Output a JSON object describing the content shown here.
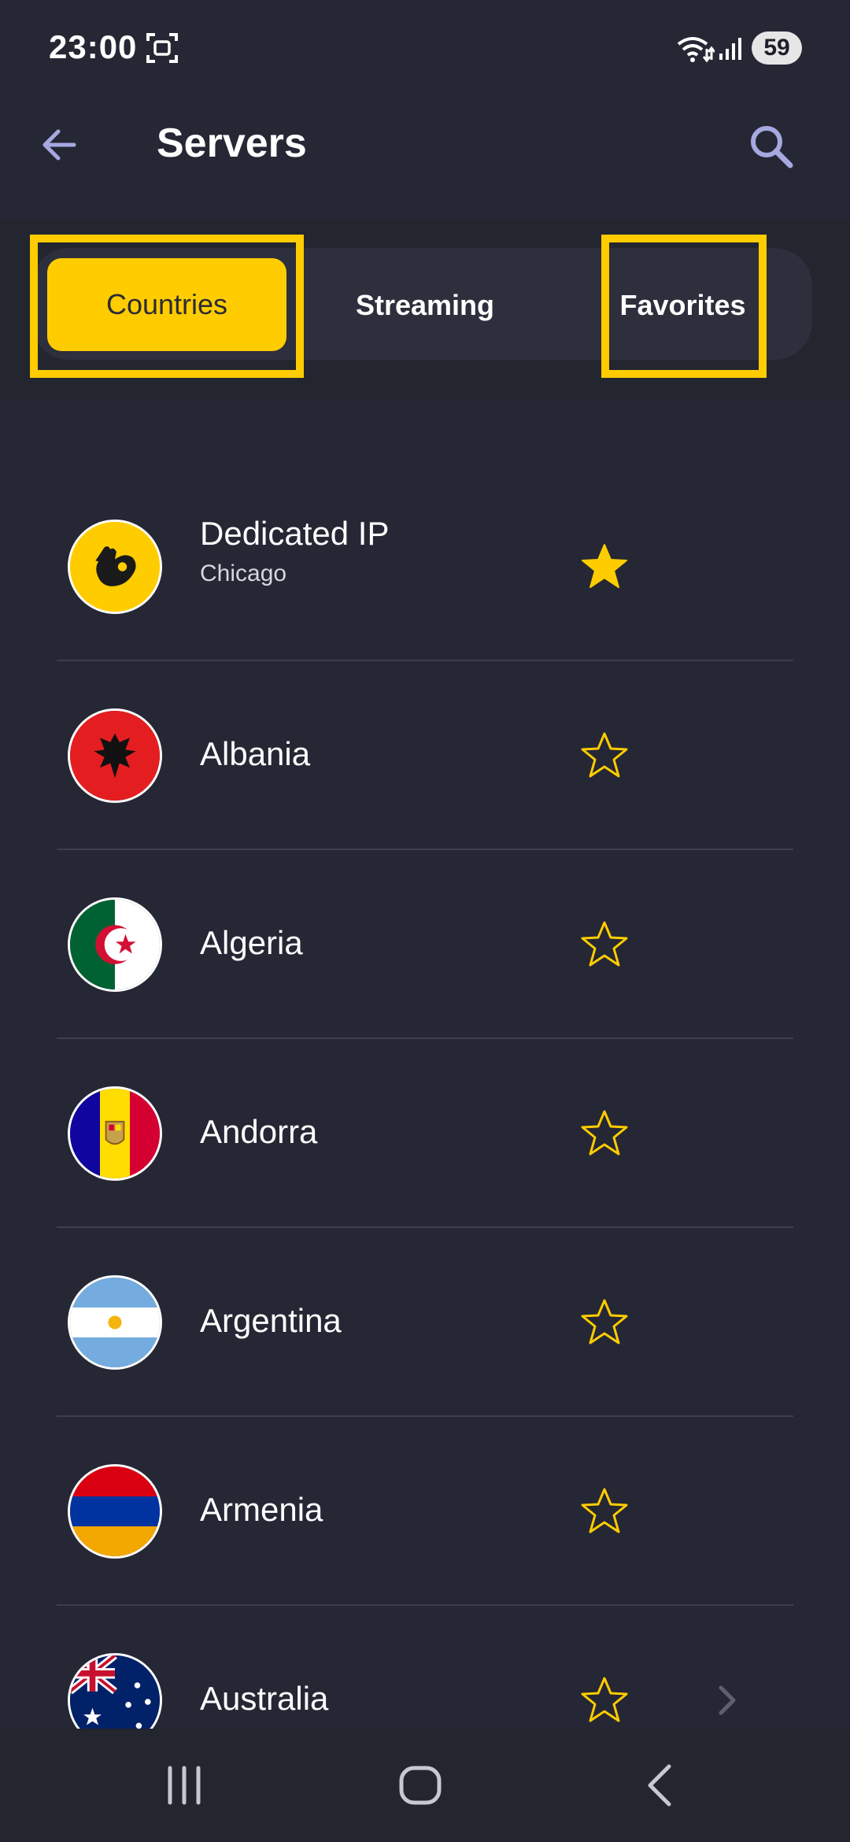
{
  "status_bar": {
    "time": "23:00",
    "battery": "59"
  },
  "header": {
    "title": "Servers"
  },
  "tabs": [
    {
      "label": "Countries",
      "selected": true
    },
    {
      "label": "Streaming",
      "selected": false
    },
    {
      "label": "Favorites",
      "selected": false
    }
  ],
  "servers": [
    {
      "name": "Dedicated IP",
      "subtitle": "Chicago",
      "favorite": true,
      "flag": "dedicated-ip-logo"
    },
    {
      "name": "Albania",
      "favorite": false,
      "flag": "albania-flag"
    },
    {
      "name": "Algeria",
      "favorite": false,
      "flag": "algeria-flag"
    },
    {
      "name": "Andorra",
      "favorite": false,
      "flag": "andorra-flag"
    },
    {
      "name": "Argentina",
      "favorite": false,
      "flag": "argentina-flag"
    },
    {
      "name": "Armenia",
      "favorite": false,
      "flag": "armenia-flag"
    },
    {
      "name": "Australia",
      "favorite": false,
      "flag": "australia-flag",
      "has_chevron": true
    }
  ],
  "colors": {
    "background": "#252734",
    "accent": "#ffcc00",
    "text": "#ffffff"
  }
}
